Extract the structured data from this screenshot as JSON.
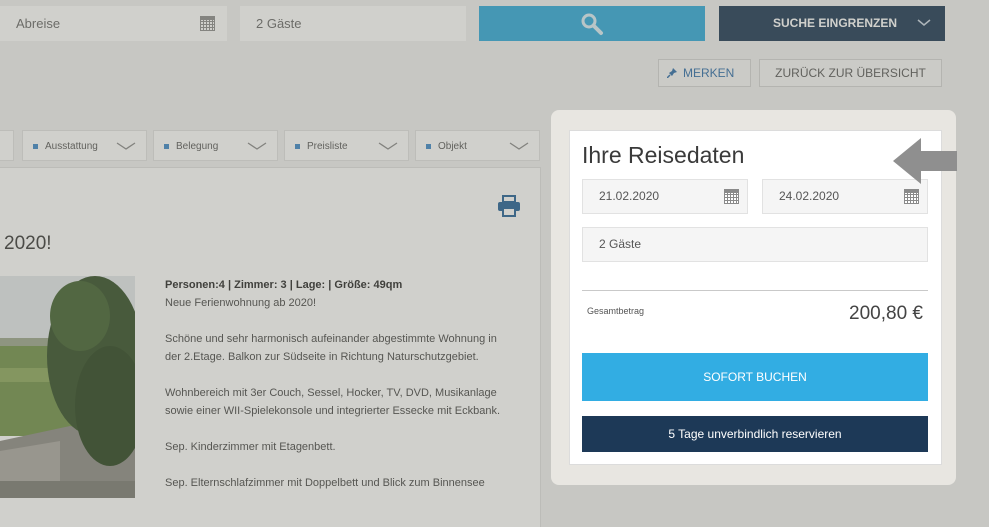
{
  "search": {
    "abreise_placeholder": "Abreise",
    "guests_value": "2 Gäste",
    "filter_label": "SUCHE EINGRENZEN"
  },
  "actions": {
    "merken_label": "MERKEN",
    "back_label": "ZURÜCK ZUR ÜBERSICHT"
  },
  "tabs": [
    {
      "label": "Ausstattung"
    },
    {
      "label": "Belegung"
    },
    {
      "label": "Preisliste"
    },
    {
      "label": "Objekt"
    }
  ],
  "listing": {
    "title_partial": "2020!",
    "meta": "Personen:4 | Zimmer: 3 | Lage: | Größe: 49qm",
    "subtitle": "Neue Ferienwohnung ab 2020!",
    "paragraphs": [
      "Schöne und sehr harmonisch aufeinander abgestimmte Wohnung in der 2.Etage. Balkon zur Südseite in Richtung Naturschutzgebiet.",
      "Wohnbereich mit 3er Couch, Sessel, Hocker, TV, DVD, Musikanlage sowie einer WII-Spielekonsole und integrierter Essecke mit Eckbank.",
      "Sep. Kinderzimmer mit Etagenbett.",
      "Sep. Elternschlafzimmer mit Doppelbett und Blick zum Binnensee"
    ]
  },
  "booking": {
    "title": "Ihre Reisedaten",
    "arrival": "21.02.2020",
    "departure": "24.02.2020",
    "guests": "2 Gäste",
    "total_label": "Gesamtbetrag",
    "total_value": "200,80 €",
    "book_label": "SOFORT BUCHEN",
    "reserve_label": "5 Tage unverbindlich reservieren"
  },
  "colors": {
    "accent": "#32ade3",
    "navy": "#1d3957"
  }
}
